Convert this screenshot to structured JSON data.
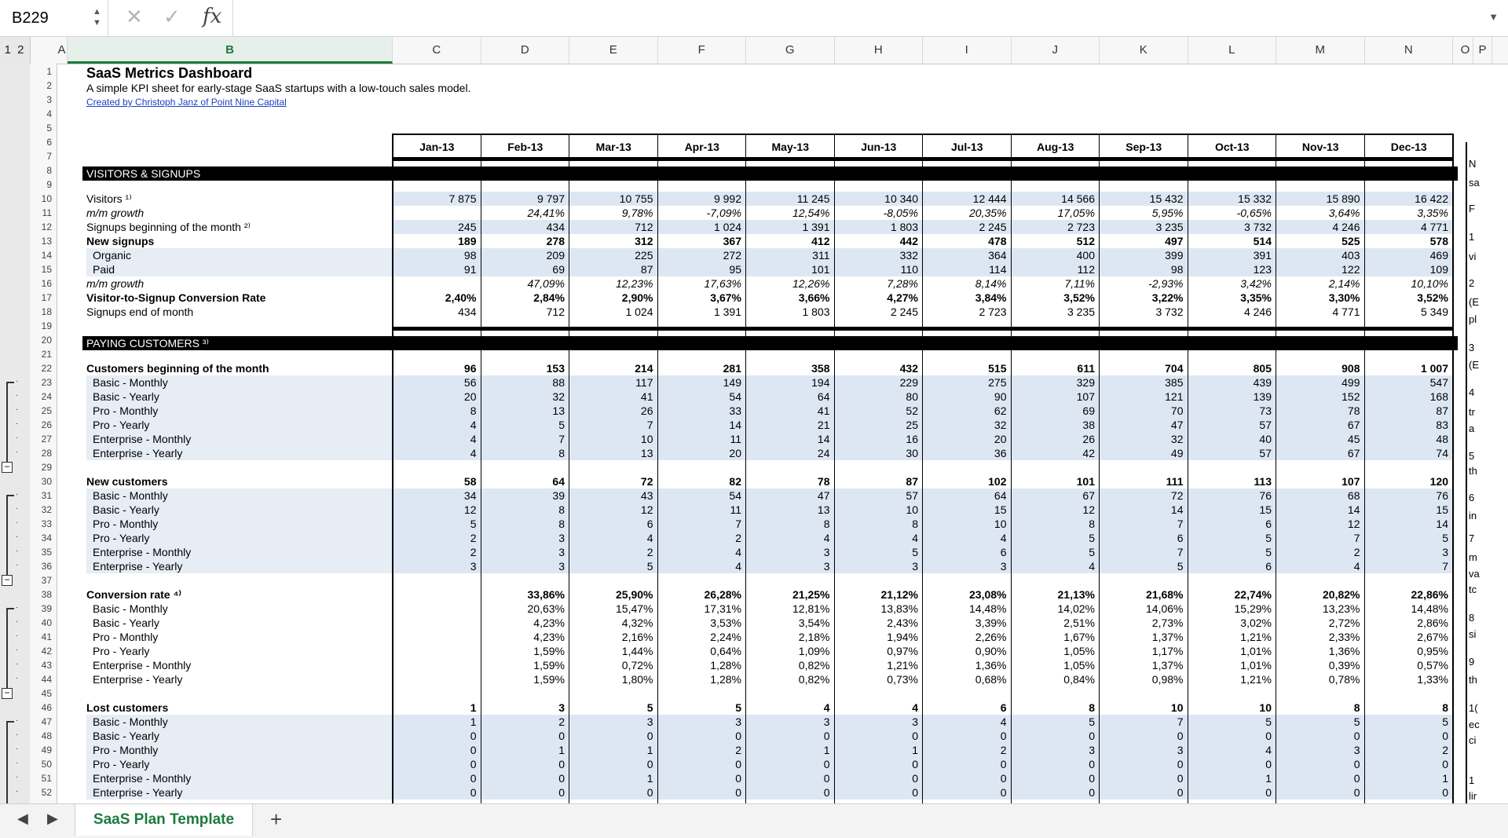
{
  "formula_bar": {
    "name_box": "B229",
    "fx_label": "fx"
  },
  "columns": [
    "A",
    "B",
    "C",
    "D",
    "E",
    "F",
    "G",
    "H",
    "I",
    "J",
    "K",
    "L",
    "M",
    "N",
    "O",
    "P"
  ],
  "outline_levels": "1 2",
  "header": {
    "title": "SaaS Metrics Dashboard",
    "subtitle": "A simple KPI sheet for early-stage SaaS startups with a low-touch sales model.",
    "credit": "Created by Christoph Janz of Point Nine Capital"
  },
  "months": [
    "Jan-13",
    "Feb-13",
    "Mar-13",
    "Apr-13",
    "May-13",
    "Jun-13",
    "Jul-13",
    "Aug-13",
    "Sep-13",
    "Oct-13",
    "Nov-13",
    "Dec-13"
  ],
  "sections": {
    "visitors": "VISITORS & SIGNUPS",
    "paying": "PAYING CUSTOMERS ³⁾"
  },
  "rows": [
    {
      "r": 10,
      "label": "Visitors ¹⁾",
      "style": "",
      "shade": true,
      "values": [
        "7 875",
        "9 797",
        "10 755",
        "9 992",
        "11 245",
        "10 340",
        "12 444",
        "14 566",
        "15 432",
        "15 332",
        "15 890",
        "16 422"
      ]
    },
    {
      "r": 11,
      "label": "m/m growth",
      "style": "i",
      "shade": false,
      "values": [
        "",
        "24,41%",
        "9,78%",
        "-7,09%",
        "12,54%",
        "-8,05%",
        "20,35%",
        "17,05%",
        "5,95%",
        "-0,65%",
        "3,64%",
        "3,35%"
      ]
    },
    {
      "r": 12,
      "label": "Signups beginning of the month ²⁾",
      "style": "",
      "shade": true,
      "values": [
        "245",
        "434",
        "712",
        "1 024",
        "1 391",
        "1 803",
        "2 245",
        "2 723",
        "3 235",
        "3 732",
        "4 246",
        "4 771"
      ]
    },
    {
      "r": 13,
      "label": "New signups",
      "style": "b",
      "shade": false,
      "values": [
        "189",
        "278",
        "312",
        "367",
        "412",
        "442",
        "478",
        "512",
        "497",
        "514",
        "525",
        "578"
      ]
    },
    {
      "r": 14,
      "label": "Organic",
      "style": "ind",
      "shade": true,
      "values": [
        "98",
        "209",
        "225",
        "272",
        "311",
        "332",
        "364",
        "400",
        "399",
        "391",
        "403",
        "469"
      ]
    },
    {
      "r": 15,
      "label": "Paid",
      "style": "ind",
      "shade": true,
      "values": [
        "91",
        "69",
        "87",
        "95",
        "101",
        "110",
        "114",
        "112",
        "98",
        "123",
        "122",
        "109"
      ]
    },
    {
      "r": 16,
      "label": "m/m growth",
      "style": "i",
      "shade": false,
      "values": [
        "",
        "47,09%",
        "12,23%",
        "17,63%",
        "12,26%",
        "7,28%",
        "8,14%",
        "7,11%",
        "-2,93%",
        "3,42%",
        "2,14%",
        "10,10%"
      ]
    },
    {
      "r": 17,
      "label": "Visitor-to-Signup Conversion Rate",
      "style": "b",
      "shade": false,
      "values": [
        "2,40%",
        "2,84%",
        "2,90%",
        "3,67%",
        "3,66%",
        "4,27%",
        "3,84%",
        "3,52%",
        "3,22%",
        "3,35%",
        "3,30%",
        "3,52%"
      ]
    },
    {
      "r": 18,
      "label": "Signups end of month",
      "style": "",
      "shade": false,
      "values": [
        "434",
        "712",
        "1 024",
        "1 391",
        "1 803",
        "2 245",
        "2 723",
        "3 235",
        "3 732",
        "4 246",
        "4 771",
        "5 349"
      ]
    },
    {
      "r": 22,
      "label": "Customers beginning of the month",
      "style": "b",
      "shade": false,
      "values": [
        "96",
        "153",
        "214",
        "281",
        "358",
        "432",
        "515",
        "611",
        "704",
        "805",
        "908",
        "1 007"
      ]
    },
    {
      "r": 23,
      "label": "Basic - Monthly",
      "style": "ind",
      "shade": true,
      "values": [
        "56",
        "88",
        "117",
        "149",
        "194",
        "229",
        "275",
        "329",
        "385",
        "439",
        "499",
        "547"
      ]
    },
    {
      "r": 24,
      "label": "Basic - Yearly",
      "style": "ind",
      "shade": true,
      "values": [
        "20",
        "32",
        "41",
        "54",
        "64",
        "80",
        "90",
        "107",
        "121",
        "139",
        "152",
        "168"
      ]
    },
    {
      "r": 25,
      "label": "Pro - Monthly",
      "style": "ind",
      "shade": true,
      "values": [
        "8",
        "13",
        "26",
        "33",
        "41",
        "52",
        "62",
        "69",
        "70",
        "73",
        "78",
        "87"
      ]
    },
    {
      "r": 26,
      "label": "Pro - Yearly",
      "style": "ind",
      "shade": true,
      "values": [
        "4",
        "5",
        "7",
        "14",
        "21",
        "25",
        "32",
        "38",
        "47",
        "57",
        "67",
        "83"
      ]
    },
    {
      "r": 27,
      "label": "Enterprise - Monthly",
      "style": "ind",
      "shade": true,
      "values": [
        "4",
        "7",
        "10",
        "11",
        "14",
        "16",
        "20",
        "26",
        "32",
        "40",
        "45",
        "48"
      ]
    },
    {
      "r": 28,
      "label": "Enterprise - Yearly",
      "style": "ind",
      "shade": true,
      "values": [
        "4",
        "8",
        "13",
        "20",
        "24",
        "30",
        "36",
        "42",
        "49",
        "57",
        "67",
        "74"
      ]
    },
    {
      "r": 30,
      "label": "New customers",
      "style": "b",
      "shade": false,
      "values": [
        "58",
        "64",
        "72",
        "82",
        "78",
        "87",
        "102",
        "101",
        "111",
        "113",
        "107",
        "120"
      ]
    },
    {
      "r": 31,
      "label": "Basic - Monthly",
      "style": "ind",
      "shade": true,
      "values": [
        "34",
        "39",
        "43",
        "54",
        "47",
        "57",
        "64",
        "67",
        "72",
        "76",
        "68",
        "76"
      ]
    },
    {
      "r": 32,
      "label": "Basic - Yearly",
      "style": "ind",
      "shade": true,
      "values": [
        "12",
        "8",
        "12",
        "11",
        "13",
        "10",
        "15",
        "12",
        "14",
        "15",
        "14",
        "15"
      ]
    },
    {
      "r": 33,
      "label": "Pro - Monthly",
      "style": "ind",
      "shade": true,
      "values": [
        "5",
        "8",
        "6",
        "7",
        "8",
        "8",
        "10",
        "8",
        "7",
        "6",
        "12",
        "14"
      ]
    },
    {
      "r": 34,
      "label": "Pro - Yearly",
      "style": "ind",
      "shade": true,
      "values": [
        "2",
        "3",
        "4",
        "2",
        "4",
        "4",
        "4",
        "5",
        "6",
        "5",
        "7",
        "5"
      ]
    },
    {
      "r": 35,
      "label": "Enterprise - Monthly",
      "style": "ind",
      "shade": true,
      "values": [
        "2",
        "3",
        "2",
        "4",
        "3",
        "5",
        "6",
        "5",
        "7",
        "5",
        "2",
        "3"
      ]
    },
    {
      "r": 36,
      "label": "Enterprise - Yearly",
      "style": "ind",
      "shade": true,
      "values": [
        "3",
        "3",
        "5",
        "4",
        "3",
        "3",
        "3",
        "4",
        "5",
        "6",
        "4",
        "7"
      ]
    },
    {
      "r": 38,
      "label": "Conversion rate ⁴⁾",
      "style": "b",
      "shade": false,
      "values": [
        "",
        "33,86%",
        "25,90%",
        "26,28%",
        "21,25%",
        "21,12%",
        "23,08%",
        "21,13%",
        "21,68%",
        "22,74%",
        "20,82%",
        "22,86%"
      ]
    },
    {
      "r": 39,
      "label": "Basic - Monthly",
      "style": "ind",
      "shade": false,
      "values": [
        "",
        "20,63%",
        "15,47%",
        "17,31%",
        "12,81%",
        "13,83%",
        "14,48%",
        "14,02%",
        "14,06%",
        "15,29%",
        "13,23%",
        "14,48%"
      ]
    },
    {
      "r": 40,
      "label": "Basic - Yearly",
      "style": "ind",
      "shade": false,
      "values": [
        "",
        "4,23%",
        "4,32%",
        "3,53%",
        "3,54%",
        "2,43%",
        "3,39%",
        "2,51%",
        "2,73%",
        "3,02%",
        "2,72%",
        "2,86%"
      ]
    },
    {
      "r": 41,
      "label": "Pro - Monthly",
      "style": "ind",
      "shade": false,
      "values": [
        "",
        "4,23%",
        "2,16%",
        "2,24%",
        "2,18%",
        "1,94%",
        "2,26%",
        "1,67%",
        "1,37%",
        "1,21%",
        "2,33%",
        "2,67%"
      ]
    },
    {
      "r": 42,
      "label": "Pro - Yearly",
      "style": "ind",
      "shade": false,
      "values": [
        "",
        "1,59%",
        "1,44%",
        "0,64%",
        "1,09%",
        "0,97%",
        "0,90%",
        "1,05%",
        "1,17%",
        "1,01%",
        "1,36%",
        "0,95%"
      ]
    },
    {
      "r": 43,
      "label": "Enterprise - Monthly",
      "style": "ind",
      "shade": false,
      "values": [
        "",
        "1,59%",
        "0,72%",
        "1,28%",
        "0,82%",
        "1,21%",
        "1,36%",
        "1,05%",
        "1,37%",
        "1,01%",
        "0,39%",
        "0,57%"
      ]
    },
    {
      "r": 44,
      "label": "Enterprise - Yearly",
      "style": "ind",
      "shade": false,
      "values": [
        "",
        "1,59%",
        "1,80%",
        "1,28%",
        "0,82%",
        "0,73%",
        "0,68%",
        "0,84%",
        "0,98%",
        "1,21%",
        "0,78%",
        "1,33%"
      ]
    },
    {
      "r": 46,
      "label": "Lost customers",
      "style": "b",
      "shade": false,
      "values": [
        "1",
        "3",
        "5",
        "5",
        "4",
        "4",
        "6",
        "8",
        "10",
        "10",
        "8",
        "8"
      ]
    },
    {
      "r": 47,
      "label": "Basic - Monthly",
      "style": "ind",
      "shade": true,
      "values": [
        "1",
        "2",
        "3",
        "3",
        "3",
        "3",
        "4",
        "5",
        "7",
        "5",
        "5",
        "5"
      ]
    },
    {
      "r": 48,
      "label": "Basic - Yearly",
      "style": "ind",
      "shade": true,
      "values": [
        "0",
        "0",
        "0",
        "0",
        "0",
        "0",
        "0",
        "0",
        "0",
        "0",
        "0",
        "0"
      ]
    },
    {
      "r": 49,
      "label": "Pro - Monthly",
      "style": "ind",
      "shade": true,
      "values": [
        "0",
        "1",
        "1",
        "2",
        "1",
        "1",
        "2",
        "3",
        "3",
        "4",
        "3",
        "2"
      ]
    },
    {
      "r": 50,
      "label": "Pro - Yearly",
      "style": "ind",
      "shade": true,
      "values": [
        "0",
        "0",
        "0",
        "0",
        "0",
        "0",
        "0",
        "0",
        "0",
        "0",
        "0",
        "0"
      ]
    },
    {
      "r": 51,
      "label": "Enterprise - Monthly",
      "style": "ind",
      "shade": true,
      "values": [
        "0",
        "0",
        "1",
        "0",
        "0",
        "0",
        "0",
        "0",
        "0",
        "1",
        "0",
        "1"
      ]
    },
    {
      "r": 52,
      "label": "Enterprise - Yearly",
      "style": "ind",
      "shade": true,
      "values": [
        "0",
        "0",
        "0",
        "0",
        "0",
        "0",
        "0",
        "0",
        "0",
        "0",
        "0",
        "0"
      ]
    }
  ],
  "right_panel": [
    "N",
    "sa",
    "F",
    "1",
    "vi",
    "2",
    "(E",
    "pl",
    "3",
    "(E",
    "4",
    "tr",
    "a",
    "5",
    "th",
    "6",
    "in",
    "7",
    "m",
    "va",
    "tc",
    "8",
    "si",
    "9",
    "th",
    "1(",
    "ec",
    "ci",
    "1",
    "lir"
  ],
  "sheet_tab": {
    "label": "SaaS Plan Template",
    "add_label": "+"
  }
}
